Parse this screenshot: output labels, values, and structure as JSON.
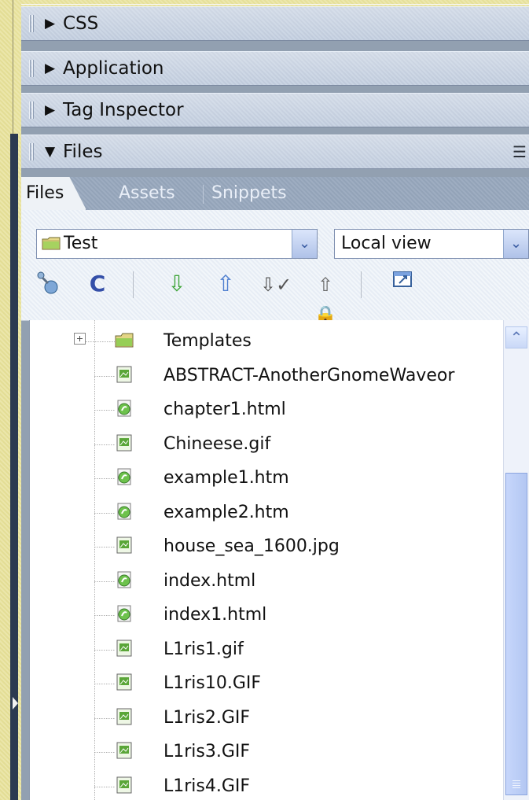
{
  "groups": [
    {
      "label": "CSS",
      "expanded": false
    },
    {
      "label": "Application",
      "expanded": false
    },
    {
      "label": "Tag Inspector",
      "expanded": false
    },
    {
      "label": "Files",
      "expanded": true
    }
  ],
  "tabs": [
    {
      "label": "Files",
      "active": true
    },
    {
      "label": "Assets",
      "active": false
    },
    {
      "label": "Snippets",
      "active": false
    }
  ],
  "site_select": {
    "value": "Test"
  },
  "view_select": {
    "value": "Local view"
  },
  "file_tree": {
    "rows": [
      {
        "name": "Templates",
        "type": "folder"
      },
      {
        "name": "ABSTRACT-AnotherGnomeWaveor",
        "type": "image"
      },
      {
        "name": "chapter1.html",
        "type": "html"
      },
      {
        "name": "Chineese.gif",
        "type": "image"
      },
      {
        "name": "example1.htm",
        "type": "html"
      },
      {
        "name": "example2.htm",
        "type": "html"
      },
      {
        "name": "house_sea_1600.jpg",
        "type": "image"
      },
      {
        "name": "index.html",
        "type": "html"
      },
      {
        "name": "index1.html",
        "type": "html"
      },
      {
        "name": "L1ris1.gif",
        "type": "image"
      },
      {
        "name": "L1ris10.GIF",
        "type": "image"
      },
      {
        "name": "L1ris2.GIF",
        "type": "image"
      },
      {
        "name": "L1ris3.GIF",
        "type": "image"
      },
      {
        "name": "L1ris4.GIF",
        "type": "image"
      }
    ]
  },
  "colors": {
    "frame": "#ece7ad",
    "panel_header": "#c9d4e3",
    "tabs": "#9eadc1",
    "toolbar": "#f2f6fa",
    "tree_bg": "#ffffff",
    "scroll": "#b3c7f2"
  }
}
